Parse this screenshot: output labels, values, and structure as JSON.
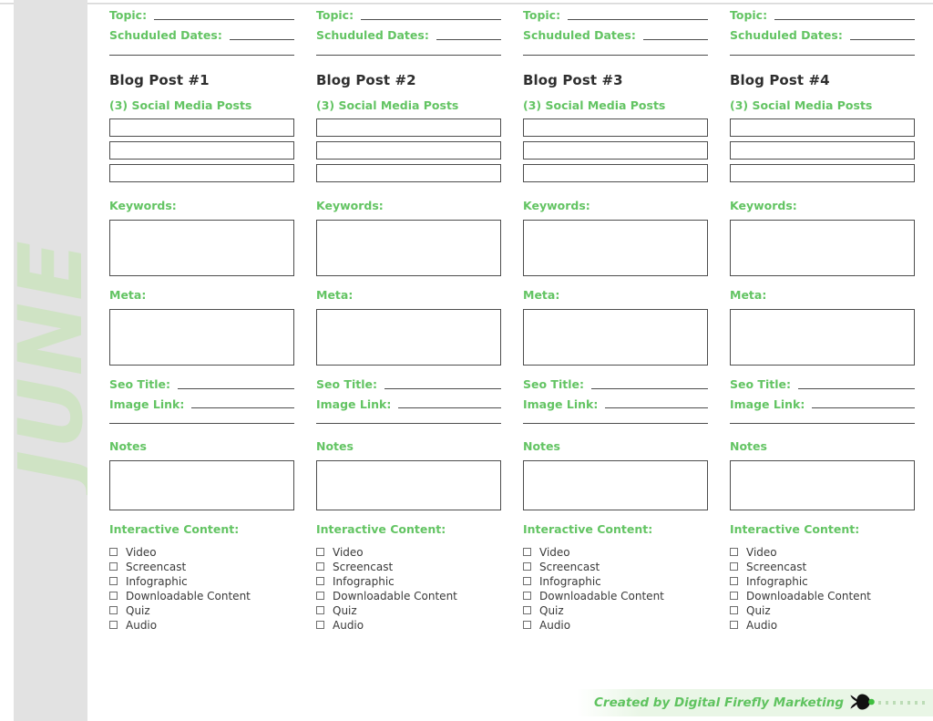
{
  "page": {
    "month_label": "JUNE",
    "accent_green": "#63c463",
    "month_green": "#cfe3c4",
    "band_gray": "#e2e2e2",
    "rule_color": "#4d4d4d"
  },
  "labels": {
    "topic": "Topic:",
    "scheduled_dates": "Schuduled Dates:",
    "social_media_posts": "(3) Social Media Posts",
    "keywords": "Keywords:",
    "meta": "Meta:",
    "seo_title": "Seo Title:",
    "image_link": "Image Link:",
    "notes": "Notes",
    "interactive_content": "Interactive Content:"
  },
  "interactive_options": [
    "Video",
    "Screencast",
    "Infographic",
    "Downloadable Content",
    "Quiz",
    "Audio"
  ],
  "columns": [
    {
      "title": "Blog Post #1",
      "topic_value": "",
      "scheduled_dates_value": "",
      "social_posts": [
        "",
        "",
        ""
      ],
      "keywords_value": "",
      "meta_value": "",
      "seo_title_value": "",
      "image_link_value": "",
      "notes_value": ""
    },
    {
      "title": "Blog Post #2",
      "topic_value": "",
      "scheduled_dates_value": "",
      "social_posts": [
        "",
        "",
        ""
      ],
      "keywords_value": "",
      "meta_value": "",
      "seo_title_value": "",
      "image_link_value": "",
      "notes_value": ""
    },
    {
      "title": "Blog Post #3",
      "topic_value": "",
      "scheduled_dates_value": "",
      "social_posts": [
        "",
        "",
        ""
      ],
      "keywords_value": "",
      "meta_value": "",
      "seo_title_value": "",
      "image_link_value": "",
      "notes_value": ""
    },
    {
      "title": "Blog Post #4",
      "topic_value": "",
      "scheduled_dates_value": "",
      "social_posts": [
        "",
        "",
        ""
      ],
      "keywords_value": "",
      "meta_value": "",
      "seo_title_value": "",
      "image_link_value": "",
      "notes_value": ""
    }
  ],
  "footer": {
    "credit": "Created by Digital Firefly Marketing",
    "logo_icon": "firefly-icon",
    "glow_color": "#3fbf3f"
  }
}
